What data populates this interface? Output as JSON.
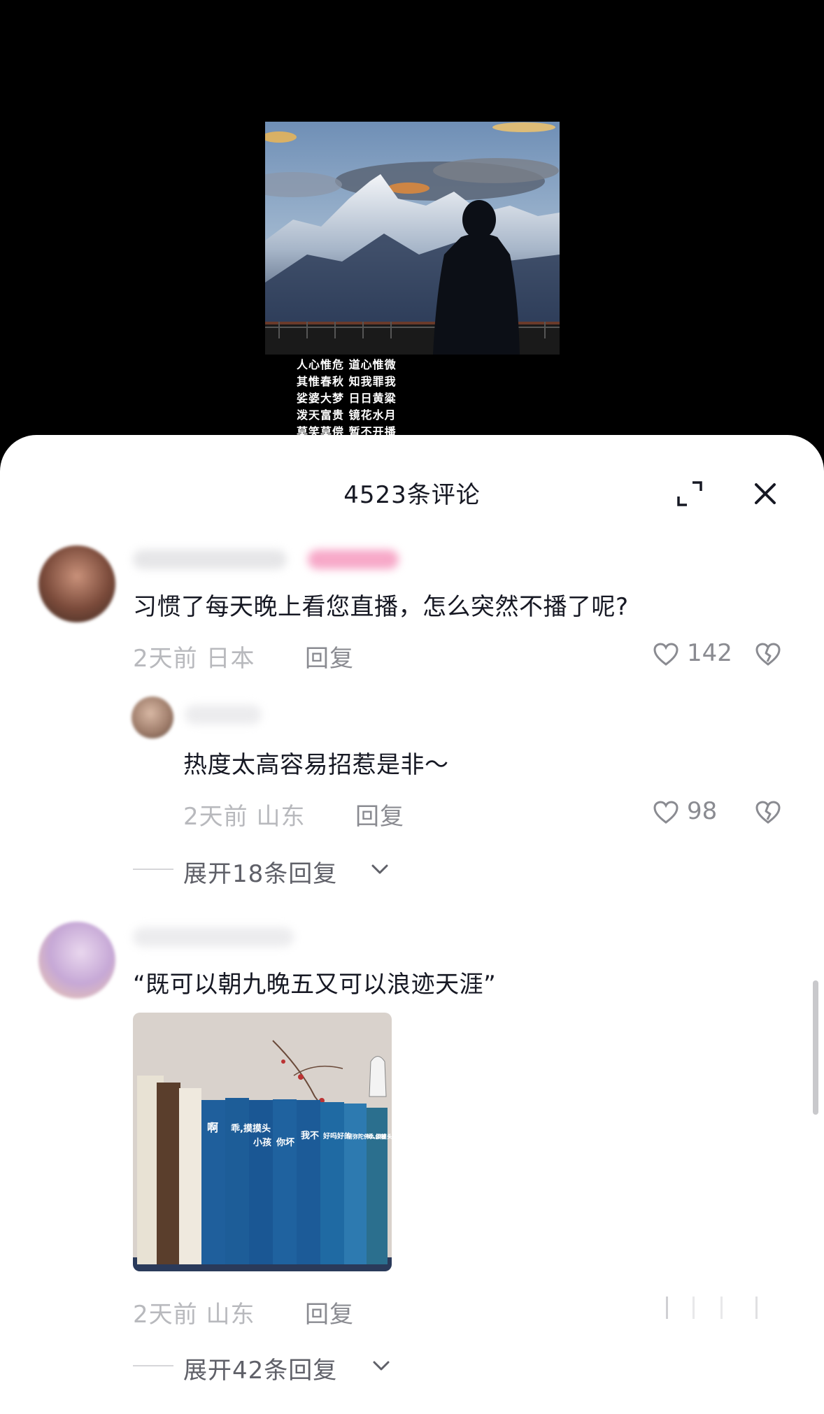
{
  "video": {
    "poem_lines": [
      "人心惟危 道心惟微",
      "其惟春秋 知我罪我",
      "娑婆大梦 日日黄粱",
      "泼天富贵 镜花水月",
      "莫笑莫偿 暂不开播"
    ]
  },
  "sheet": {
    "title": "4523条评论",
    "expand_icon": "fullscreen-expand-icon",
    "close_icon": "close-icon"
  },
  "comments": [
    {
      "text": "习惯了每天晚上看您直播，怎么突然不播了呢?",
      "meta": "2天前 日本",
      "reply_label": "回复",
      "likes": "142",
      "replies": [
        {
          "text": "热度太高容易招惹是非～",
          "meta": "2天前 山东",
          "reply_label": "回复",
          "likes": "98"
        }
      ],
      "expand_label": "展开18条回复"
    },
    {
      "text": "“既可以朝九晚五又可以浪迹天涯”",
      "image_books": [
        "啊",
        "乖,摸摸头",
        "小孩",
        "你坏",
        "我不",
        "好吗好的",
        "阿弥陀佛么么哒",
        "乖,摸摸头"
      ],
      "meta": "2天前 山东",
      "reply_label": "回复",
      "expand_label": "展开42条回复"
    }
  ],
  "colors": {
    "primary_text": "#161823",
    "secondary_text": "#8a8b91",
    "meta_text": "#b8b9bd",
    "background": "#ffffff"
  }
}
